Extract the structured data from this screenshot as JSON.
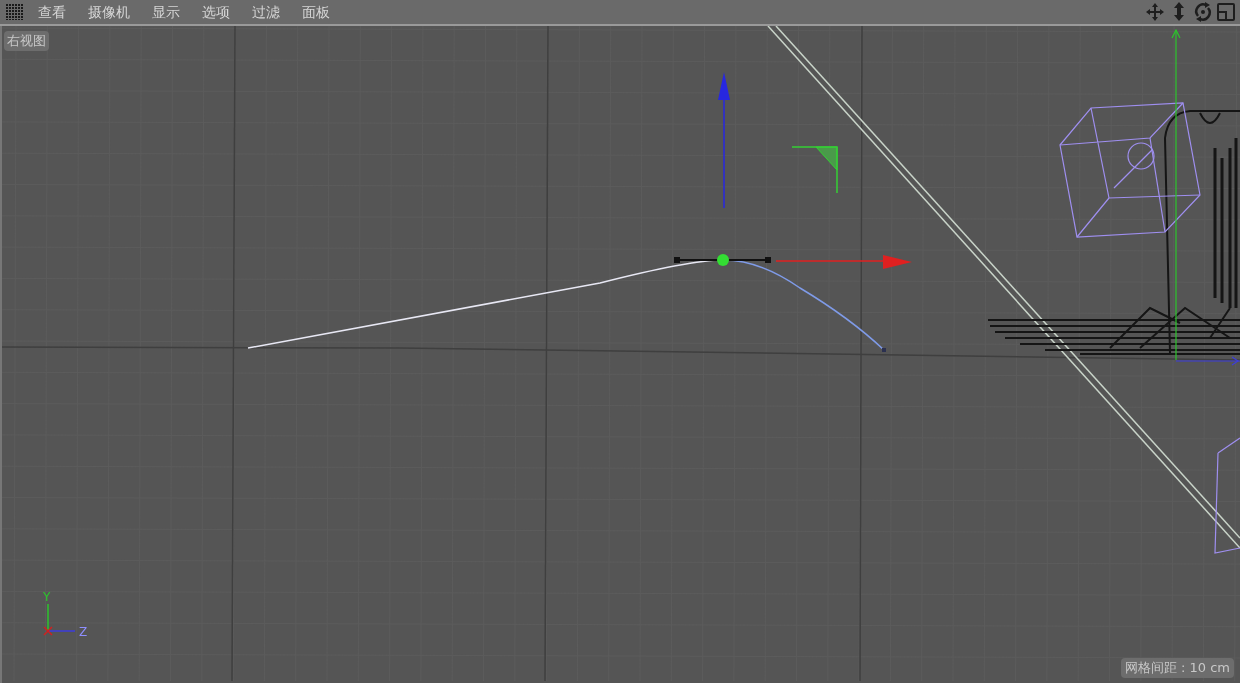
{
  "menu_bar": {
    "items": [
      "查看",
      "摄像机",
      "显示",
      "选项",
      "过滤",
      "面板"
    ]
  },
  "viewport": {
    "view_label": "右视图",
    "axis_labels": {
      "y": "Y",
      "z": "Z"
    },
    "grid_spacing": "网格间距 : 10 cm"
  }
}
